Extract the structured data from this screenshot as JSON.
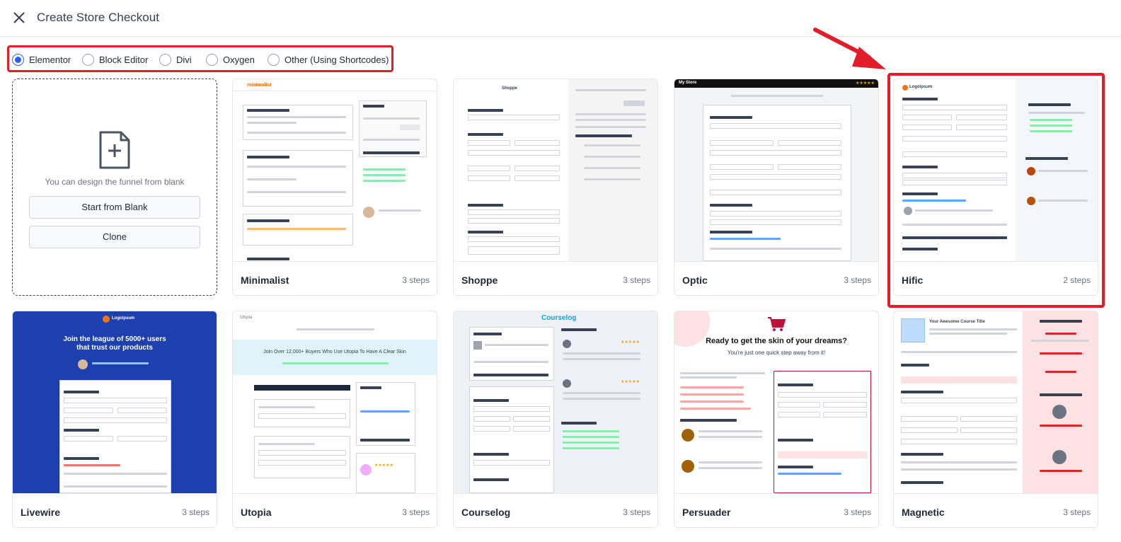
{
  "header": {
    "title": "Create Store Checkout",
    "close_icon": "close-icon"
  },
  "builders": [
    {
      "label": "Elementor",
      "selected": true
    },
    {
      "label": "Block Editor",
      "selected": false
    },
    {
      "label": "Divi",
      "selected": false
    },
    {
      "label": "Oxygen",
      "selected": false
    },
    {
      "label": "Other (Using Shortcodes)",
      "selected": false
    }
  ],
  "blank": {
    "description": "You can design the funnel from blank",
    "start_label": "Start from Blank",
    "clone_label": "Clone"
  },
  "templates": [
    {
      "name": "Minimalist",
      "steps": "3 steps",
      "brand": "minimalist",
      "accent": "#f97316"
    },
    {
      "name": "Shoppe",
      "steps": "3 steps",
      "brand": "Shoppe",
      "accent": "#111827"
    },
    {
      "name": "Optic",
      "steps": "3 steps",
      "brand": "My Store",
      "accent": "#111111"
    },
    {
      "name": "Hific",
      "steps": "2 steps",
      "brand": "Logoipsum",
      "accent": "#f97316"
    },
    {
      "name": "Livewire",
      "steps": "3 steps",
      "brand": "Logoipsum",
      "accent": "#1e40af",
      "headline": "Join the league of 5000+ users that trust our products"
    },
    {
      "name": "Utopia",
      "steps": "3 steps",
      "brand": "Utopia",
      "accent": "#a5d8e6",
      "headline": "Join Over 12,000+ Buyers Who Use Utopia To Have A Clear Skin"
    },
    {
      "name": "Courselog",
      "steps": "3 steps",
      "brand": "Courselog",
      "accent": "#0ea5e9"
    },
    {
      "name": "Persuader",
      "steps": "3 steps",
      "brand": "",
      "accent": "#be123c",
      "headline": "Ready to get the skin of your dreams?",
      "subheadline": "You're just one quick step away from it!"
    },
    {
      "name": "Magnetic",
      "steps": "3 steps",
      "brand": "Your Awesome Course Title",
      "accent": "#fecaca"
    }
  ]
}
